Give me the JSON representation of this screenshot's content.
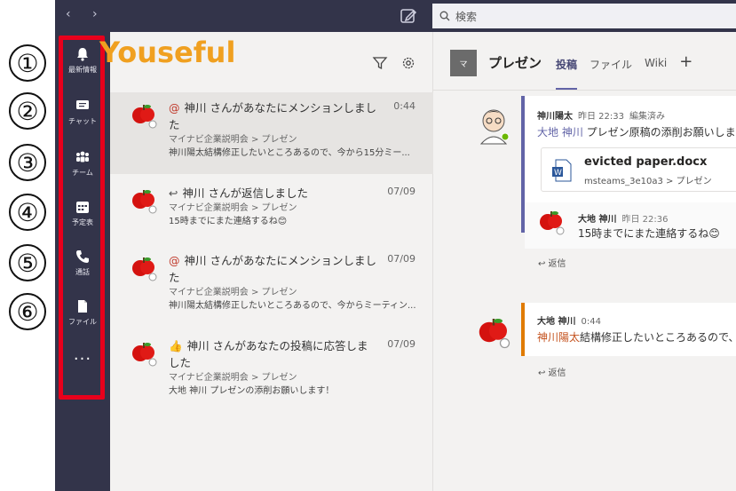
{
  "numbers": [
    "①",
    "②",
    "③",
    "④",
    "⑤",
    "⑥"
  ],
  "brand": "Youseful",
  "topbar": {
    "nav": "‹ ›",
    "search_placeholder": "検索"
  },
  "rail": {
    "items": [
      {
        "label": "最新情報",
        "icon": "bell-icon"
      },
      {
        "label": "チャット",
        "icon": "chat-icon"
      },
      {
        "label": "チーム",
        "icon": "teams-icon"
      },
      {
        "label": "予定表",
        "icon": "calendar-icon"
      },
      {
        "label": "通話",
        "icon": "phone-icon"
      },
      {
        "label": "ファイル",
        "icon": "file-icon"
      }
    ],
    "more": "···"
  },
  "activity": {
    "items": [
      {
        "glyph": "@",
        "title": "神川 さんがあなたにメンションしました",
        "time": "0:44",
        "sub": "マイナビ企業説明会 > プレゼン",
        "body": "神川陽太結構修正したいところあるので、今から15分ミー..."
      },
      {
        "glyph": "↩",
        "title": "神川 さんが返信しました",
        "time": "07/09",
        "sub": "マイナビ企業説明会 > プレゼン",
        "body": "15時までにまた連絡するね😊"
      },
      {
        "glyph": "@",
        "title": "神川 さんがあなたにメンションしました",
        "time": "07/09",
        "sub": "マイナビ企業説明会 > プレゼン",
        "body": "神川陽太結構修正したいところあるので、今からミーティン..."
      },
      {
        "glyph": "👍",
        "title": "神川 さんがあなたの投稿に応答しました",
        "time": "07/09",
        "sub": "マイナビ企業説明会 > プレゼン",
        "body": "大地 神川 プレゼンの添削お願いします！"
      }
    ]
  },
  "channel": {
    "badge": "マ",
    "name": "プレゼン",
    "tabs": [
      "投稿",
      "ファイル",
      "Wiki"
    ],
    "plus": "+"
  },
  "post1": {
    "author": "神川陽太",
    "time": "昨日 22:33",
    "edited": "編集済み",
    "mention": "大地 神川",
    "text": " プレゼン原稿の添削お願いしま",
    "file_name": "evicted paper.docx",
    "file_path": "msteams_3e10a3 > プレゼン",
    "reply_author": "大地 神川",
    "reply_time": "昨日 22:36",
    "reply_text": "15時までにまた連絡するね😊",
    "reply_link": "↩ 返信"
  },
  "post2": {
    "author": "大地 神川",
    "time": "0:44",
    "mention": "神川陽太",
    "text": "結構修正したいところあるので、",
    "reply_link": "↩ 返信"
  }
}
